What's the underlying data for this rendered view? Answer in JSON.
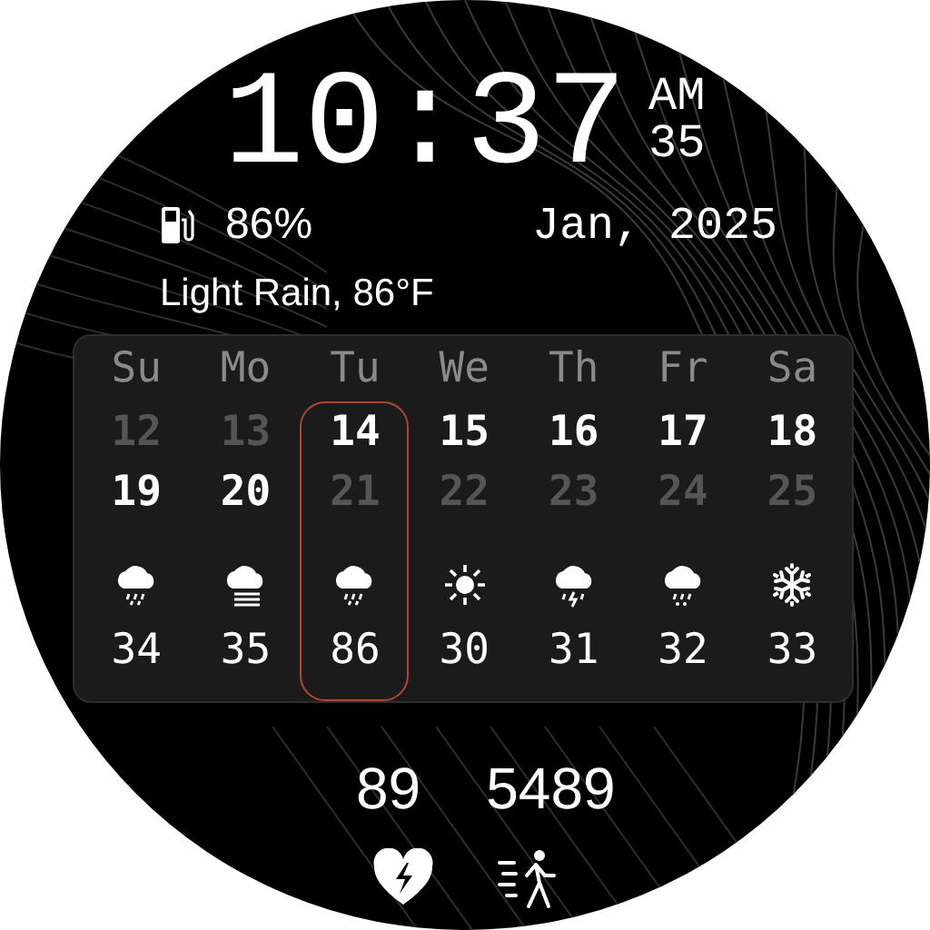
{
  "time": {
    "clock": "10:37",
    "period": "AM",
    "seconds": "35"
  },
  "battery": {
    "percent": "86%"
  },
  "date": "Jan, 2025",
  "weather": "Light Rain, 86°F",
  "calendar": [
    {
      "day": "Su",
      "selected": false,
      "dates": [
        {
          "text": "12",
          "dimmed": true
        },
        {
          "text": "19",
          "dimmed": false
        }
      ],
      "forecast": {
        "kind": "rain",
        "temp": "34"
      }
    },
    {
      "day": "Mo",
      "selected": false,
      "dates": [
        {
          "text": "13",
          "dimmed": true
        },
        {
          "text": "20",
          "dimmed": false
        }
      ],
      "forecast": {
        "kind": "fog",
        "temp": "35"
      }
    },
    {
      "day": "Tu",
      "selected": true,
      "dates": [
        {
          "text": "14",
          "dimmed": false
        },
        {
          "text": "21",
          "dimmed": true
        }
      ],
      "forecast": {
        "kind": "rain",
        "temp": "86"
      }
    },
    {
      "day": "We",
      "selected": false,
      "dates": [
        {
          "text": "15",
          "dimmed": false
        },
        {
          "text": "22",
          "dimmed": true
        }
      ],
      "forecast": {
        "kind": "sun",
        "temp": "30"
      }
    },
    {
      "day": "Th",
      "selected": false,
      "dates": [
        {
          "text": "16",
          "dimmed": false
        },
        {
          "text": "23",
          "dimmed": true
        }
      ],
      "forecast": {
        "kind": "thunder",
        "temp": "31"
      }
    },
    {
      "day": "Fr",
      "selected": false,
      "dates": [
        {
          "text": "17",
          "dimmed": false
        },
        {
          "text": "24",
          "dimmed": true
        }
      ],
      "forecast": {
        "kind": "sleet",
        "temp": "32"
      }
    },
    {
      "day": "Sa",
      "selected": false,
      "dates": [
        {
          "text": "18",
          "dimmed": false
        },
        {
          "text": "25",
          "dimmed": true
        }
      ],
      "forecast": {
        "kind": "snow",
        "temp": "33"
      }
    }
  ],
  "stats": {
    "heart_rate": "89",
    "steps": "5489"
  }
}
